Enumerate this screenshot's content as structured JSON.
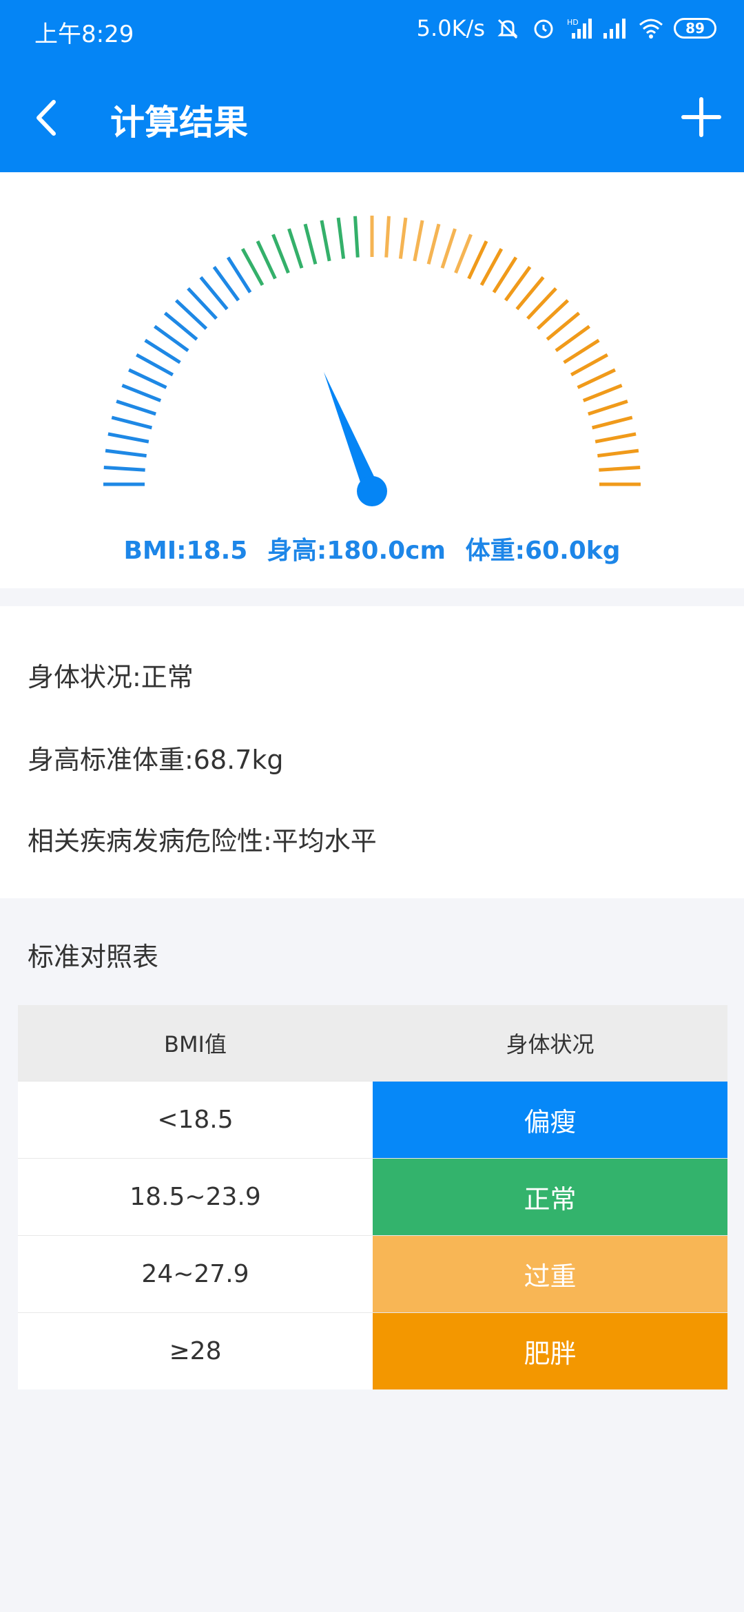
{
  "status_bar": {
    "time": "上午8:29",
    "network_speed": "5.0K/s",
    "battery_level": "89",
    "icons": [
      "bell-off-icon",
      "alarm-icon",
      "hd-signal-icon",
      "signal-icon",
      "wifi-icon",
      "battery-icon"
    ]
  },
  "app_bar": {
    "title": "计算结果",
    "back_icon": "chevron-left-icon",
    "action_icon": "plus-icon"
  },
  "gauge": {
    "bmi_value": 18.5,
    "colors": {
      "blue": "#1e88e5",
      "green": "#34b06a",
      "light_orange": "#f5b453",
      "orange": "#f09a1a"
    },
    "summary": {
      "bmi": "BMI:18.5",
      "height": "身高:180.0cm",
      "weight": "体重:60.0kg"
    }
  },
  "info": {
    "condition": "身体状况:正常",
    "standard_weight": "身高标准体重:68.7kg",
    "risk": "相关疾病发病危险性:平均水平"
  },
  "reference": {
    "title": "标准对照表",
    "headers": [
      "BMI值",
      "身体状况"
    ],
    "rows": [
      {
        "value": "<18.5",
        "status": "偏瘦",
        "color": "#0688f8"
      },
      {
        "value": "18.5~23.9",
        "status": "正常",
        "color": "#33b36c"
      },
      {
        "value": "24~27.9",
        "status": "过重",
        "color": "#f8b655"
      },
      {
        "value": "≥28",
        "status": "肥胖",
        "color": "#f39700"
      }
    ]
  }
}
